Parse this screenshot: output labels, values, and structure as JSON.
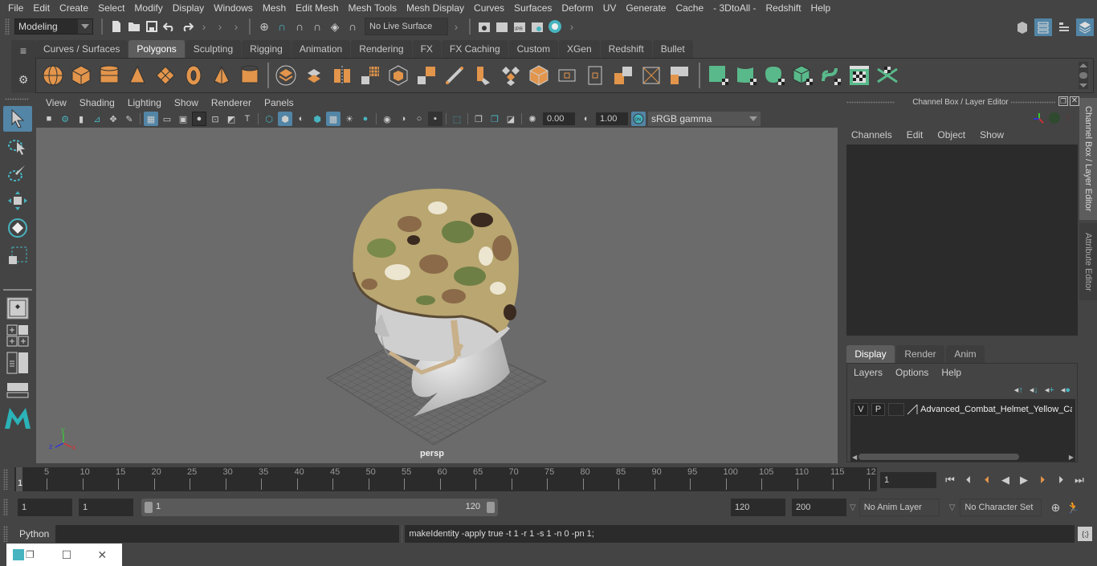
{
  "menubar": {
    "items": [
      "File",
      "Edit",
      "Create",
      "Select",
      "Modify",
      "Display",
      "Windows",
      "Mesh",
      "Edit Mesh",
      "Mesh Tools",
      "Mesh Display",
      "Curves",
      "Surfaces",
      "Deform",
      "UV",
      "Generate",
      "Cache",
      "- 3DtoAll -",
      "Redshift",
      "Help"
    ]
  },
  "statusline": {
    "workspace": "Modeling",
    "live_surface": "No Live Surface"
  },
  "shelf": {
    "tabs": [
      "Curves / Surfaces",
      "Polygons",
      "Sculpting",
      "Rigging",
      "Animation",
      "Rendering",
      "FX",
      "FX Caching",
      "Custom",
      "XGen",
      "Redshift",
      "Bullet"
    ],
    "active_tab": "Polygons",
    "orange_icons": [
      "poly-sphere-icon",
      "poly-cube-icon",
      "poly-cylinder-icon",
      "poly-cone-icon",
      "poly-plane-icon",
      "poly-torus-icon",
      "poly-pyramid-icon",
      "poly-pipe-icon"
    ],
    "mid_icons": [
      "combine-icon",
      "separate-icon",
      "mirror-icon",
      "smooth-icon",
      "extrude-icon",
      "bevel-icon",
      "bridge-icon",
      "multicut-icon",
      "insert-edgeloop-icon",
      "merge-icon",
      "fill-hole-icon",
      "target-weld-icon",
      "edge-loop-icon",
      "triangulate-icon",
      "quadrangulate-icon",
      "boolean-icon"
    ],
    "green_icons": [
      "planar-uv-icon",
      "cylindrical-uv-icon",
      "spherical-uv-icon",
      "automatic-uv-icon",
      "unfold-uv-icon",
      "uv-editor-icon",
      "cut-sew-uv-icon"
    ]
  },
  "viewport": {
    "menu": [
      "View",
      "Shading",
      "Lighting",
      "Show",
      "Renderer",
      "Panels"
    ],
    "exposure": "0.00",
    "gamma": "1.00",
    "color_management_on": "ON",
    "color_space": "sRGB gamma",
    "camera_label": "persp",
    "axis": {
      "x": "x",
      "y": "y",
      "z": "z"
    }
  },
  "channelbox": {
    "title": "Channel Box / Layer Editor",
    "menu": [
      "Channels",
      "Edit",
      "Object",
      "Show"
    ],
    "layer_tabs": [
      "Display",
      "Render",
      "Anim"
    ],
    "active_layer_tab": "Display",
    "layer_menu": [
      "Layers",
      "Options",
      "Help"
    ],
    "layers": [
      {
        "v": "V",
        "p": "P",
        "name": "Advanced_Combat_Helmet_Yellow_Ca"
      }
    ]
  },
  "right_tabs": [
    "Channel Box / Layer Editor",
    "Attribute Editor"
  ],
  "timeline": {
    "ticks": [
      "5",
      "10",
      "15",
      "20",
      "25",
      "30",
      "35",
      "40",
      "45",
      "50",
      "55",
      "60",
      "65",
      "70",
      "75",
      "80",
      "85",
      "90",
      "95",
      "100",
      "105",
      "110",
      "115",
      "12"
    ],
    "current_marker": "1",
    "current_frame": "1"
  },
  "range": {
    "start": "1",
    "playback_start": "1",
    "slider_start": "1",
    "slider_end": "120",
    "playback_end": "120",
    "end": "200",
    "anim_layer": "No Anim Layer",
    "character_set": "No Character Set"
  },
  "cmdline": {
    "language": "Python",
    "input": "",
    "result": "makeIdentity -apply true -t 1 -r 1 -s 1 -n 0 -pn 1;"
  },
  "colors": {
    "accent": "#5285a6",
    "shelf_orange": "#e2954b",
    "shelf_green": "#59b98a",
    "teal": "#47b4c0"
  }
}
